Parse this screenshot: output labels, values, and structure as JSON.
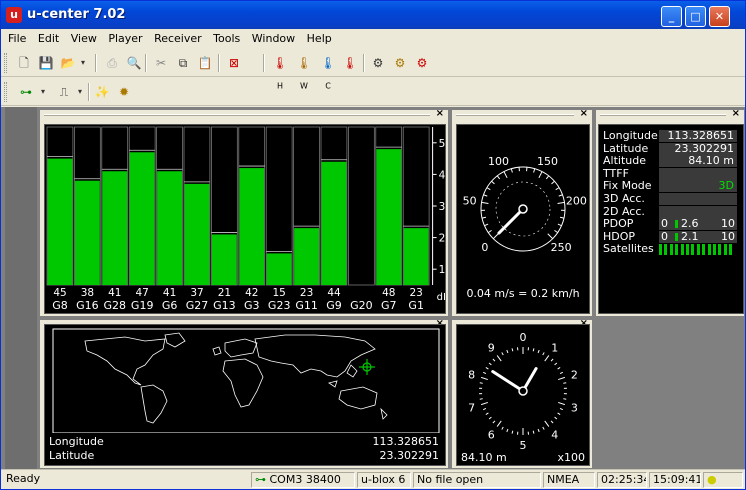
{
  "window": {
    "title": "u-center 7.02",
    "app_icon": "u"
  },
  "menu": [
    "File",
    "Edit",
    "View",
    "Player",
    "Receiver",
    "Tools",
    "Window",
    "Help"
  ],
  "toolbar_thermo": {
    "h": "H",
    "w": "W",
    "c": "C"
  },
  "snr": {
    "y_ticks": [
      "50",
      "40",
      "30",
      "20",
      "10"
    ],
    "unit": "dB",
    "sats": [
      {
        "id": "G8",
        "val": "45",
        "level": 45,
        "dim": false
      },
      {
        "id": "G16",
        "val": "38",
        "level": 38,
        "dim": false
      },
      {
        "id": "G28",
        "val": "41",
        "level": 41,
        "dim": false
      },
      {
        "id": "G19",
        "val": "47",
        "level": 47,
        "dim": false
      },
      {
        "id": "G6",
        "val": "41",
        "level": 41,
        "dim": false
      },
      {
        "id": "G27",
        "val": "37",
        "level": 37,
        "dim": false
      },
      {
        "id": "G13",
        "val": "21",
        "level": 21,
        "dim": false
      },
      {
        "id": "G3",
        "val": "42",
        "level": 42,
        "dim": false
      },
      {
        "id": "G23",
        "val": "15",
        "level": 15,
        "dim": false
      },
      {
        "id": "G11",
        "val": "23",
        "level": 23,
        "dim": false
      },
      {
        "id": "G9",
        "val": "44",
        "level": 44,
        "dim": false
      },
      {
        "id": "G20",
        "val": "",
        "level": 0,
        "dim": false
      },
      {
        "id": "G7",
        "val": "48",
        "level": 48,
        "dim": false
      },
      {
        "id": "G1",
        "val": "23",
        "level": 23,
        "dim": false
      }
    ]
  },
  "speed": {
    "ticks": [
      "0",
      "50",
      "100",
      "150",
      "200",
      "250"
    ],
    "readout": "0.04 m/s = 0.2 km/h",
    "value": 0.04
  },
  "info": {
    "rows": [
      {
        "label": "Longitude",
        "value": "113.328651"
      },
      {
        "label": "Latitude",
        "value": "23.302291"
      },
      {
        "label": "Altitude",
        "value": "84.10 m"
      },
      {
        "label": "TTFF",
        "value": ""
      },
      {
        "label": "Fix Mode",
        "value": "3D"
      },
      {
        "label": "3D Acc.",
        "value": ""
      },
      {
        "label": "2D Acc.",
        "value": ""
      }
    ],
    "pdop": {
      "label": "PDOP",
      "min": "0",
      "val": "2.6",
      "max": "10",
      "fraction": 0.26
    },
    "hdop": {
      "label": "HDOP",
      "min": "0",
      "val": "2.1",
      "max": "10",
      "fraction": 0.21
    },
    "satellites_label": "Satellites",
    "sat_bars": 14
  },
  "map": {
    "lon_label": "Longitude",
    "lon": "113.328651",
    "lat_label": "Latitude",
    "lat": "23.302291"
  },
  "altimeter": {
    "ticks": [
      "0",
      "1",
      "2",
      "3",
      "4",
      "5",
      "6",
      "7",
      "8",
      "9"
    ],
    "readout": "84.10 m",
    "scale": "x100"
  },
  "status": {
    "ready": "Ready",
    "port": "COM3 38400",
    "receiver": "u-blox 6",
    "file": "No file open",
    "protocol": "NMEA",
    "time1": "02:25:34",
    "time2": "15:09:41"
  },
  "colors": {
    "green": "#00c800",
    "accent": "#0a5fe8"
  }
}
